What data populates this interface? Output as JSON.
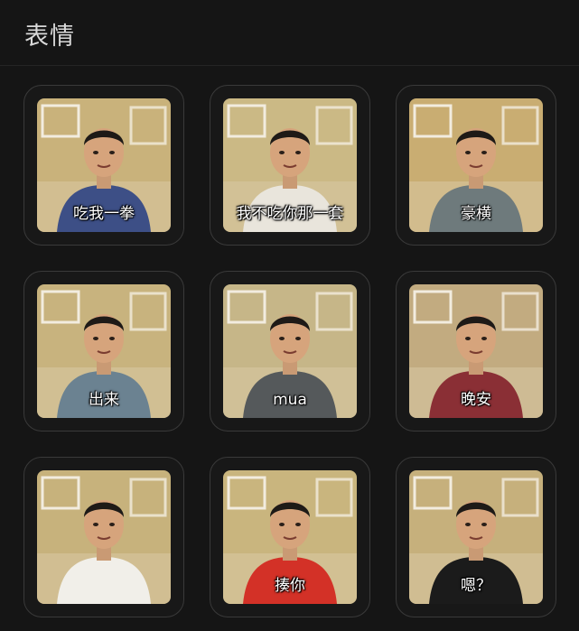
{
  "header": {
    "title": "表情"
  },
  "stickers": [
    {
      "caption": "吃我一拳",
      "icon": "punch-sticker",
      "shirt": "#3d4f86",
      "bg": "#c9b27b"
    },
    {
      "caption": "我不吃你那一套",
      "icon": "refuse-sticker",
      "shirt": "#e9e5dc",
      "bg": "#cbb985"
    },
    {
      "caption": "豪横",
      "icon": "swagger-sticker",
      "shirt": "#6e7a7c",
      "bg": "#c9ad72"
    },
    {
      "caption": "出来",
      "icon": "megaphone-sticker",
      "shirt": "#6b8291",
      "bg": "#c8b37e"
    },
    {
      "caption": "mua",
      "icon": "kiss-sticker",
      "shirt": "#55595b",
      "bg": "#c6b688"
    },
    {
      "caption": "晚安",
      "icon": "goodnight-sticker",
      "shirt": "#8a2f35",
      "bg": "#c2ab80"
    },
    {
      "caption": "",
      "icon": "salute-sticker",
      "shirt": "#f1efe9",
      "bg": "#c7b27c"
    },
    {
      "caption": "揍你",
      "icon": "flex-sticker",
      "shirt": "#d33127",
      "bg": "#c9b57e"
    },
    {
      "caption": "嗯？",
      "icon": "confused-sticker",
      "shirt": "#1b1b1b",
      "bg": "#c6b07c"
    }
  ]
}
